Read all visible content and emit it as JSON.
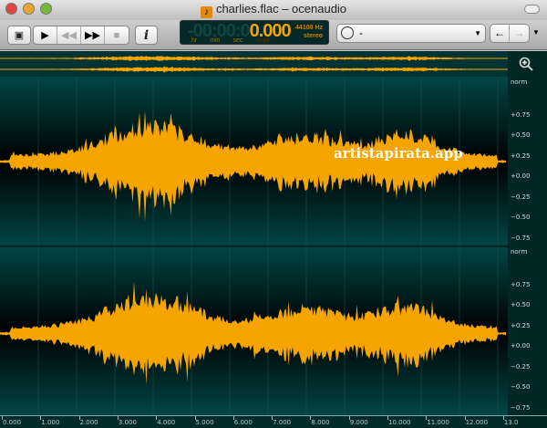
{
  "window": {
    "title": "charlies.flac – ocenaudio",
    "file_icon": "music-note-icon"
  },
  "toolbar": {
    "buttons": [
      {
        "name": "view",
        "icon": "▣"
      },
      {
        "name": "play",
        "icon": "▶"
      },
      {
        "name": "rewind",
        "icon": "◀◀",
        "disabled": true
      },
      {
        "name": "fast-forward",
        "icon": "▶▶"
      },
      {
        "name": "stop",
        "icon": "■",
        "disabled": true
      },
      {
        "name": "info",
        "icon": "i"
      }
    ],
    "time_display": {
      "dim": "-00:00:0",
      "value": "0.000",
      "units": [
        "hr",
        "min",
        "sec",
        "smpl"
      ],
      "rate": "44100 Hz",
      "channels": "stereo"
    },
    "history_combo": {
      "value": "-"
    },
    "back": "←",
    "forward": "→"
  },
  "watermark": "artistapirata.app",
  "scale": {
    "labels": [
      "norm",
      "+0.75",
      "+0.50",
      "+0.25",
      "+0.00",
      "−0.25",
      "−0.50",
      "−0.75"
    ]
  },
  "time_axis": [
    "0.000",
    "1.000",
    "2.000",
    "3.000",
    "4.000",
    "5.000",
    "6.000",
    "7.000",
    "8.000",
    "9.000",
    "10.000",
    "11.000",
    "12.000",
    "13.0"
  ],
  "colors": {
    "waveform": "#f6a400",
    "background": "#012a2a"
  }
}
